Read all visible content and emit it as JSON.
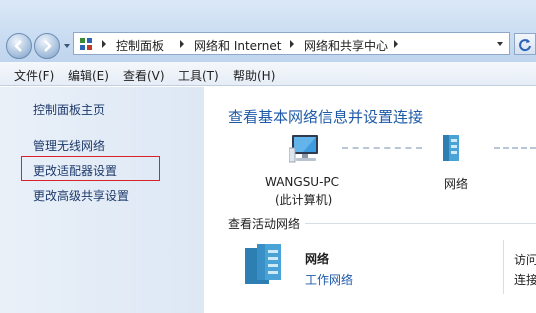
{
  "address_bar": {
    "breadcrumbs": [
      "控制面板",
      "网络和 Internet",
      "网络和共享中心"
    ]
  },
  "menu": {
    "items": [
      "文件(F)",
      "编辑(E)",
      "查看(V)",
      "工具(T)",
      "帮助(H)"
    ]
  },
  "sidebar": {
    "items": [
      "控制面板主页",
      "管理无线网络",
      "更改适配器设置",
      "更改高级共享设置"
    ],
    "highlighted_item": "更改适配器设置",
    "highlight_color": "#d9222a"
  },
  "main": {
    "title": "查看基本网络信息并设置连接",
    "computer_name": "WANGSU-PC",
    "computer_subtitle": "(此计算机)",
    "network_label": "网络",
    "active_networks_label": "查看活动网络",
    "active_network": {
      "name": "网络",
      "type": "工作网络"
    },
    "right_labels": [
      "访问",
      "连接"
    ]
  },
  "colors": {
    "title_blue": "#1e5aa8",
    "link_blue": "#1e3a6b",
    "sidebar_bg": "#e9f0f8"
  },
  "icons": [
    "back-arrow-icon",
    "forward-arrow-icon",
    "control-panel-icon",
    "refresh-icon",
    "computer-icon",
    "network-icon"
  ]
}
